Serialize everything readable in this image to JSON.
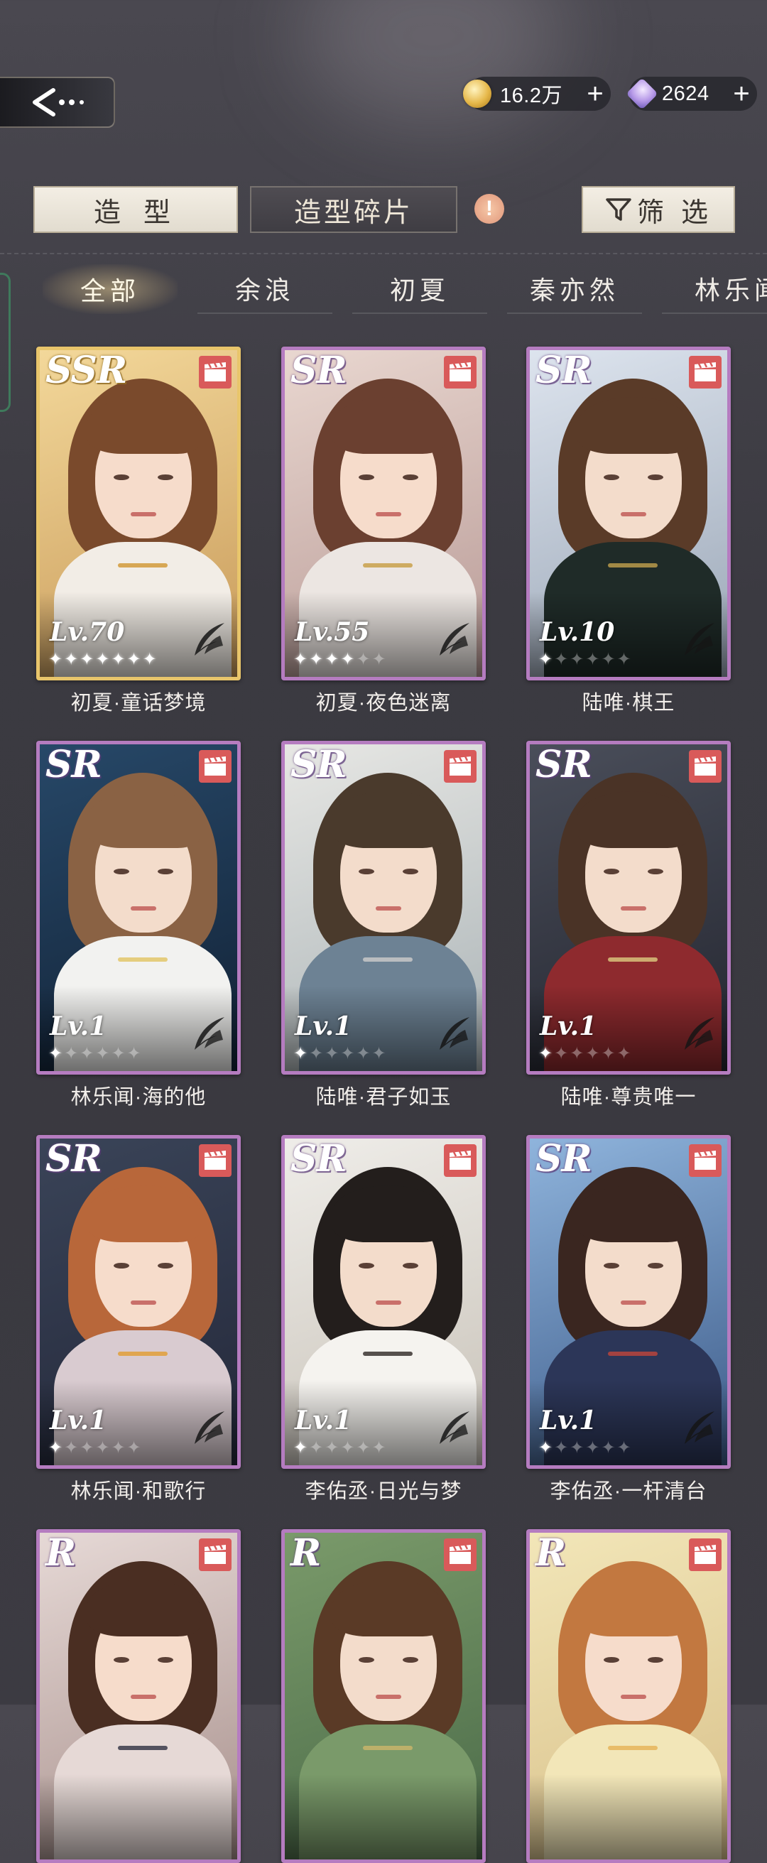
{
  "currency": {
    "coins": {
      "icon": "coin-icon",
      "value": "16.2万",
      "plus": "+"
    },
    "gems": {
      "icon": "gem-icon",
      "value": "2624",
      "plus": "+"
    }
  },
  "tabs": {
    "outfit": "造 型",
    "fragments": "造型碎片",
    "warning": "!",
    "filter": "筛 选"
  },
  "characters": [
    "全部",
    "余浪",
    "初夏",
    "秦亦然",
    "林乐闻"
  ],
  "cards": [
    {
      "rarity": "SSR",
      "level": "Lv.70",
      "stars": 7,
      "stars_total": 7,
      "name": "初夏·童话梦境",
      "bg": [
        "#f3d89a",
        "#c89a5a"
      ],
      "hair": "#7a4a2c",
      "skin": "#f6dccb",
      "body": "#f2ede6",
      "accent": "#d29a3a"
    },
    {
      "rarity": "SR",
      "level": "Lv.55",
      "stars": 4,
      "stars_total": 6,
      "name": "初夏·夜色迷离",
      "bg": [
        "#e9d7d0",
        "#b89a96"
      ],
      "hair": "#6b4030",
      "skin": "#f6dccb",
      "body": "#ece6e2",
      "accent": "#c9a04a"
    },
    {
      "rarity": "SR",
      "level": "Lv.10",
      "stars": 1,
      "stars_total": 6,
      "name": "陆唯·棋王",
      "bg": [
        "#dde4ee",
        "#9aa6b6"
      ],
      "hair": "#5a3b28",
      "skin": "#f3dccb",
      "body": "#1f2b28",
      "accent": "#b99a4a"
    },
    {
      "rarity": "SR",
      "level": "Lv.1",
      "stars": 1,
      "stars_total": 6,
      "name": "林乐闻·海的他",
      "bg": [
        "#274868",
        "#122236"
      ],
      "hair": "#8a6244",
      "skin": "#f3dccb",
      "body": "#f2f2f0",
      "accent": "#e3c76a"
    },
    {
      "rarity": "SR",
      "level": "Lv.1",
      "stars": 1,
      "stars_total": 6,
      "name": "陆唯·君子如玉",
      "bg": [
        "#e7e7e4",
        "#aab3b6"
      ],
      "hair": "#4a3a2c",
      "skin": "#f3dccb",
      "body": "#6d8294",
      "accent": "#c8c8c8"
    },
    {
      "rarity": "SR",
      "level": "Lv.1",
      "stars": 1,
      "stars_total": 6,
      "name": "陆唯·尊贵唯一",
      "bg": [
        "#4a4e5a",
        "#242630"
      ],
      "hair": "#4a3326",
      "skin": "#f3dccb",
      "body": "#8e2a2e",
      "accent": "#d8c27a"
    },
    {
      "rarity": "SR",
      "level": "Lv.1",
      "stars": 1,
      "stars_total": 6,
      "name": "林乐闻·和歌行",
      "bg": [
        "#3a4458",
        "#24283a"
      ],
      "hair": "#b8673a",
      "skin": "#f6dccb",
      "body": "#d9cbd0",
      "accent": "#e0a03a"
    },
    {
      "rarity": "SR",
      "level": "Lv.1",
      "stars": 1,
      "stars_total": 6,
      "name": "李佑丞·日光与梦",
      "bg": [
        "#efede9",
        "#c8c2b8"
      ],
      "hair": "#231e1c",
      "skin": "#f3dccb",
      "body": "#f5f3ef",
      "accent": "#3a3230"
    },
    {
      "rarity": "SR",
      "level": "Lv.1",
      "stars": 1,
      "stars_total": 6,
      "name": "李佑丞·一杆清台",
      "bg": [
        "#8fb4dc",
        "#3c5a88"
      ],
      "hair": "#3a2620",
      "skin": "#f3dccb",
      "body": "#2c3658",
      "accent": "#b8443c"
    },
    {
      "rarity": "R",
      "level": "",
      "stars": 0,
      "stars_total": 0,
      "name": "",
      "bg": [
        "#e6d9d6",
        "#a8908c"
      ],
      "hair": "#4a2e22",
      "skin": "#f6dccb",
      "body": "#e6d9d6",
      "accent": "#3a3a4a"
    },
    {
      "rarity": "R",
      "level": "",
      "stars": 0,
      "stars_total": 0,
      "name": "",
      "bg": [
        "#7a9a6a",
        "#4a6a48"
      ],
      "hair": "#5a3a26",
      "skin": "#f3dccb",
      "body": "#7a9a6a",
      "accent": "#c8b46a"
    },
    {
      "rarity": "R",
      "level": "",
      "stars": 0,
      "stars_total": 0,
      "name": "",
      "bg": [
        "#f2e6b8",
        "#d8c08a"
      ],
      "hair": "#c27840",
      "skin": "#f6dccb",
      "body": "#f2e6b8",
      "accent": "#e6b45a"
    }
  ]
}
